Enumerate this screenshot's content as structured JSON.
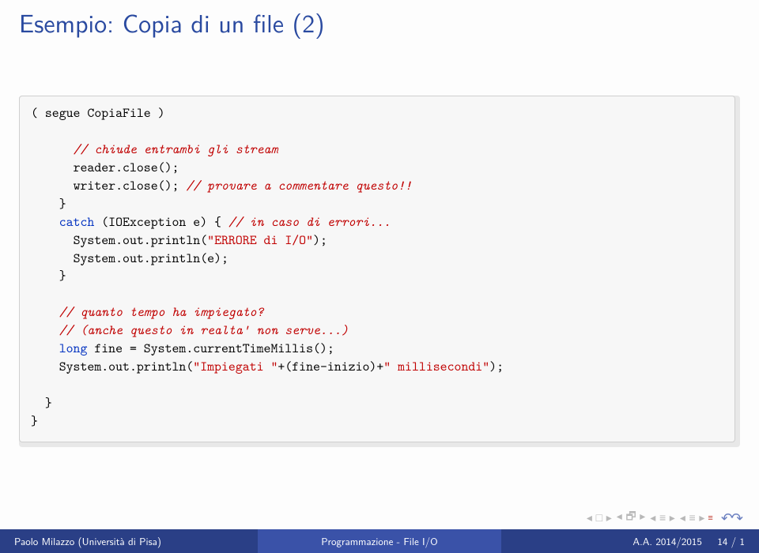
{
  "title": "Esempio: Copia di un file (2)",
  "code": {
    "l1_a": "( segue CopiaFile )",
    "l2_c": "// chiude entrambi gli stream",
    "l3": "reader.close();",
    "l4_a": "writer.close(); ",
    "l4_c": "// provare a commentare questo!!",
    "l5": "}",
    "l6_a": "catch",
    "l6_b": " (IOException e) { ",
    "l6_c": "// in caso di errori...",
    "l7_a": "System.out.println(",
    "l7_s": "\"ERRORE di I/O\"",
    "l7_b": ");",
    "l8": "System.out.println(e);",
    "l9": "}",
    "l10_c": "// quanto tempo ha impiegato?",
    "l11_c": "// (anche questo in realta' non serve...)",
    "l12_a": "long",
    "l12_b": " fine = System.currentTimeMillis();",
    "l13_a": "System.out.println(",
    "l13_s": "\"Impiegati \"",
    "l13_b": "+(fine-inizio)+",
    "l13_s2": "\" millisecondi\"",
    "l13_c": ");",
    "l14": "}",
    "l15": "}"
  },
  "footer": {
    "author": "Paolo Milazzo (Università di Pisa)",
    "title": "Programmazione - File I/O",
    "date": "A.A. 2014/2015",
    "page": "14 / 1"
  }
}
